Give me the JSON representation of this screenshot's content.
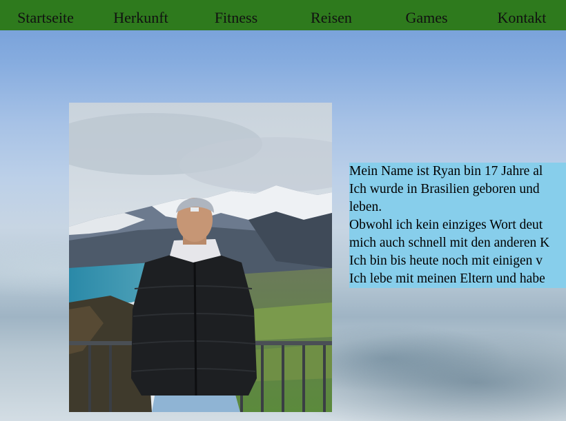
{
  "nav": {
    "items": [
      "Startseite",
      "Herkunft",
      "Fitness",
      "Reisen",
      "Games",
      "Kontakt"
    ]
  },
  "colors": {
    "nav_background": "#2e7a1d",
    "bio_background": "#87ceeb"
  },
  "bio": {
    "lines": [
      "Mein Name ist Ryan bin 17 Jahre al",
      "Ich wurde in Brasilien geboren und",
      "leben.",
      "Obwohl ich kein einziges Wort deut",
      "mich auch schnell mit den anderen K",
      "Ich bin bis heute noch mit einigen v",
      "Ich lebe mit meinen Eltern und habe"
    ]
  }
}
